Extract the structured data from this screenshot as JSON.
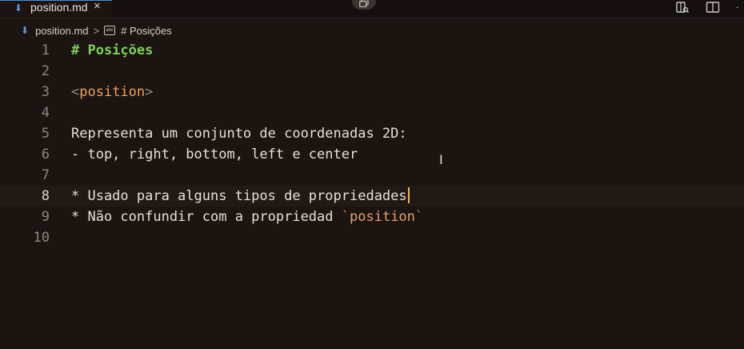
{
  "tab": {
    "icon": "markdown-icon",
    "label": "position.md",
    "close": "×"
  },
  "top_actions": {
    "icons": [
      "open-preview-icon",
      "split-editor-icon",
      "more-actions-icon"
    ],
    "more": "·"
  },
  "breadcrumb": {
    "file": "position.md",
    "separator": ">",
    "symbol_icon_text": "abc",
    "section": "# Posições"
  },
  "editor": {
    "lines": [
      {
        "number": "1",
        "text": "# Posições",
        "kind": "heading"
      },
      {
        "number": "2",
        "text": "",
        "kind": "empty"
      },
      {
        "number": "3",
        "text": "<position>",
        "kind": "tag",
        "tag_open": "<",
        "tag_name": "position",
        "tag_close": ">"
      },
      {
        "number": "4",
        "text": "",
        "kind": "empty"
      },
      {
        "number": "5",
        "text": "Representa um conjunto de coordenadas 2D:",
        "kind": "text"
      },
      {
        "number": "6",
        "text": "- top, right, bottom, left e center",
        "kind": "text"
      },
      {
        "number": "7",
        "text": "",
        "kind": "empty"
      },
      {
        "number": "8",
        "text": "* Usado para alguns tipos de propriedades",
        "kind": "text",
        "current": true
      },
      {
        "number": "9",
        "text": "* Não confundir com a propriedad `position`",
        "kind": "mixed",
        "prefix": "* Não confundir com a propriedad ",
        "tick": "`",
        "code": "position"
      },
      {
        "number": "10",
        "text": "",
        "kind": "empty"
      }
    ]
  },
  "colors": {
    "background": "#1b1411",
    "heading": "#7fd05a",
    "tag_name": "#f0a45e",
    "cursor": "#f5b04c",
    "tab_accent": "#4a8fd6"
  }
}
